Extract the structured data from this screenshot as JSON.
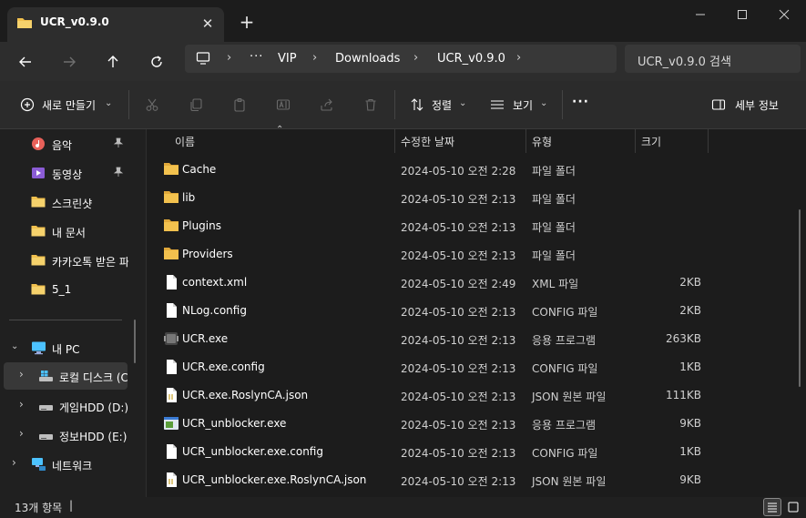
{
  "window": {
    "tab_title": "UCR_v0.9.0",
    "close_tab_glyph": "✕",
    "new_tab_glyph": "+"
  },
  "nav": {
    "breadcrumbs": [
      "VIP",
      "Downloads",
      "UCR_v0.9.0"
    ],
    "more_glyph": "···",
    "search_placeholder": "UCR_v0.9.0 검색"
  },
  "toolbar": {
    "new_label": "새로 만들기",
    "sort_label": "정렬",
    "view_label": "보기",
    "more_glyph": "···",
    "details_label": "세부 정보"
  },
  "sidebar": {
    "quick": [
      {
        "label": "음악",
        "icon": "music-icon",
        "pinned": true
      },
      {
        "label": "동영상",
        "icon": "video-icon",
        "pinned": true
      },
      {
        "label": "스크린샷",
        "icon": "folder-icon",
        "pinned": false
      },
      {
        "label": "내 문서",
        "icon": "folder-icon",
        "pinned": false
      },
      {
        "label": "카카오톡 받은 파",
        "icon": "folder-icon",
        "pinned": false
      },
      {
        "label": "5_1",
        "icon": "folder-icon",
        "pinned": false
      }
    ],
    "pc": {
      "label": "내 PC"
    },
    "drives": [
      {
        "label": "로컬 디스크 (C",
        "icon": "windows-drive-icon"
      },
      {
        "label": "게임HDD (D:)",
        "icon": "drive-icon"
      },
      {
        "label": "정보HDD (E:)",
        "icon": "drive-icon"
      }
    ],
    "network": {
      "label": "네트워크"
    }
  },
  "columns": {
    "name": "이름",
    "date": "수정한 날짜",
    "type": "유형",
    "size": "크기"
  },
  "files": [
    {
      "name": "Cache",
      "date": "2024-05-10 오전 2:28",
      "type": "파일 폴더",
      "size": "",
      "icon": "folder-icon"
    },
    {
      "name": "lib",
      "date": "2024-05-10 오전 2:13",
      "type": "파일 폴더",
      "size": "",
      "icon": "folder-icon"
    },
    {
      "name": "Plugins",
      "date": "2024-05-10 오전 2:13",
      "type": "파일 폴더",
      "size": "",
      "icon": "folder-icon"
    },
    {
      "name": "Providers",
      "date": "2024-05-10 오전 2:13",
      "type": "파일 폴더",
      "size": "",
      "icon": "folder-icon"
    },
    {
      "name": "context.xml",
      "date": "2024-05-10 오전 2:49",
      "type": "XML 파일",
      "size": "2KB",
      "icon": "file-icon"
    },
    {
      "name": "NLog.config",
      "date": "2024-05-10 오전 2:13",
      "type": "CONFIG 파일",
      "size": "2KB",
      "icon": "file-icon"
    },
    {
      "name": "UCR.exe",
      "date": "2024-05-10 오전 2:13",
      "type": "응용 프로그램",
      "size": "263KB",
      "icon": "app-icon"
    },
    {
      "name": "UCR.exe.config",
      "date": "2024-05-10 오전 2:13",
      "type": "CONFIG 파일",
      "size": "1KB",
      "icon": "file-icon"
    },
    {
      "name": "UCR.exe.RoslynCA.json",
      "date": "2024-05-10 오전 2:13",
      "type": "JSON 원본 파일",
      "size": "111KB",
      "icon": "json-file-icon"
    },
    {
      "name": "UCR_unblocker.exe",
      "date": "2024-05-10 오전 2:13",
      "type": "응용 프로그램",
      "size": "9KB",
      "icon": "exe-window-icon"
    },
    {
      "name": "UCR_unblocker.exe.config",
      "date": "2024-05-10 오전 2:13",
      "type": "CONFIG 파일",
      "size": "1KB",
      "icon": "file-icon"
    },
    {
      "name": "UCR_unblocker.exe.RoslynCA.json",
      "date": "2024-05-10 오전 2:13",
      "type": "JSON 원본 파일",
      "size": "9KB",
      "icon": "json-file-icon"
    }
  ],
  "status": {
    "count_text": "13개 항목",
    "caret": "|"
  },
  "colors": {
    "folder": "#f2c14e",
    "accent": "#4cc2ff",
    "background": "#202020"
  }
}
